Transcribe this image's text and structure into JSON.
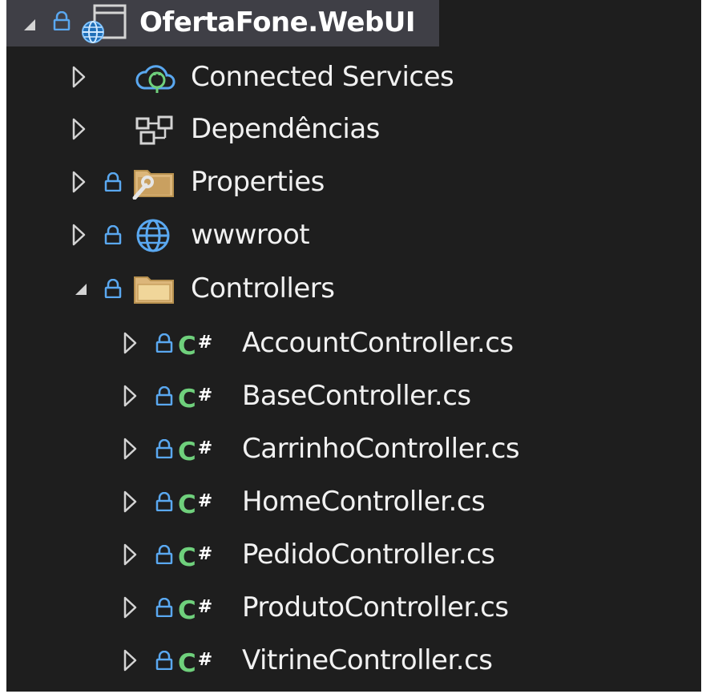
{
  "solution_explorer": {
    "project": {
      "name": "OfertaFone.WebUI",
      "expanded": true
    },
    "nodes": [
      {
        "label": "Connected Services",
        "icon": "cloud-plug-icon",
        "locked": false,
        "expanded": false
      },
      {
        "label": "Dependências",
        "icon": "dependencies-icon",
        "locked": false,
        "expanded": false
      },
      {
        "label": "Properties",
        "icon": "properties-folder-icon",
        "locked": true,
        "expanded": false
      },
      {
        "label": "wwwroot",
        "icon": "globe-icon",
        "locked": true,
        "expanded": false
      },
      {
        "label": "Controllers",
        "icon": "folder-icon",
        "locked": true,
        "expanded": true
      }
    ],
    "controllers": [
      {
        "label": "AccountController.cs"
      },
      {
        "label": "BaseController.cs"
      },
      {
        "label": "CarrinhoController.cs"
      },
      {
        "label": "HomeController.cs"
      },
      {
        "label": "PedidoController.cs"
      },
      {
        "label": "ProdutoController.cs"
      },
      {
        "label": "VitrineController.cs"
      }
    ],
    "file_type_glyph": {
      "letter": "C",
      "symbol": "#"
    },
    "colors": {
      "background": "#1e1e1e",
      "selected_row": "#3f3f46",
      "lock": "#5aa8f0",
      "csharp": "#6fd07c",
      "folder": "#dcb67a",
      "text": "#f1f1f1"
    }
  }
}
